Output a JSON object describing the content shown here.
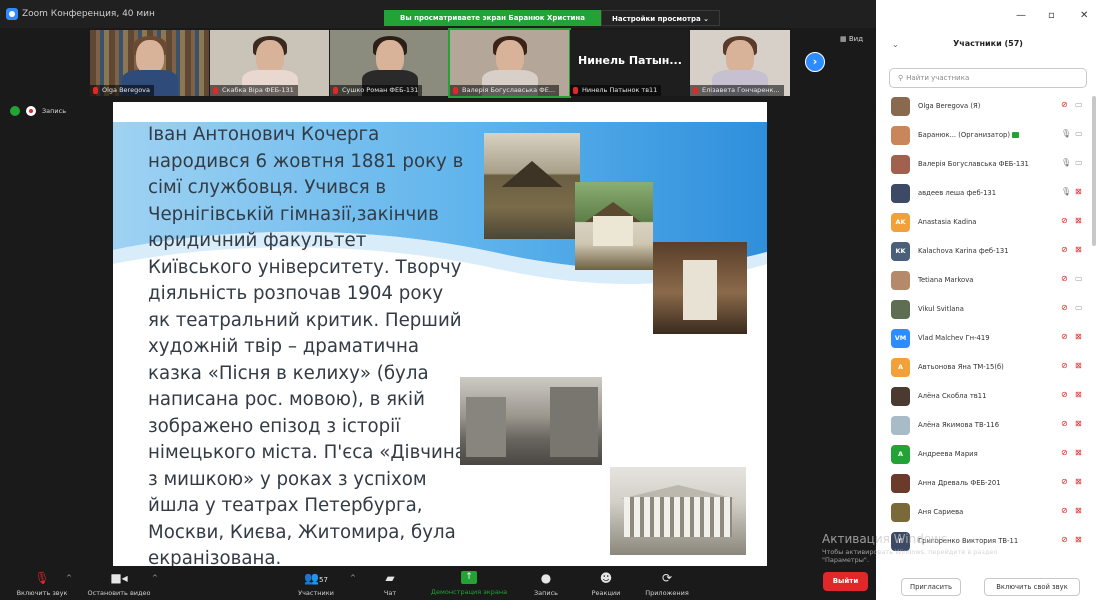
{
  "titlebar": {
    "title": "Zoom Конференция, 40 мин"
  },
  "share_banner": {
    "text": "Вы просматриваете экран Баранюк Христина",
    "options": "Настройки просмотра ⌄"
  },
  "thumbnails": [
    {
      "name": "Olga Beregova"
    },
    {
      "name": "Скабка Віра ФЕБ-131"
    },
    {
      "name": "Сушко Роман ФЕБ-131"
    },
    {
      "name": "Валерія Богуславська ФЕ..."
    },
    {
      "name": "Нинель Патынок тв11",
      "big_name": "Нинель  Патын..."
    },
    {
      "name": "Елізавета Гончаренк..."
    }
  ],
  "view_button": "▦ Вид",
  "record": {
    "label": "Запись"
  },
  "slide": {
    "lines": [
      "Іван Антонович Кочерга",
      "народився 6 жовтня 1881 року в",
      "сімї службовця. Учився в",
      "Чернігівській гімназії,закінчив",
      "юридичний факультет",
      "Київського університету. Творчу",
      "діяльність розпочав 1904 року",
      "як театральний критик. Перший",
      "художній твір – драматична",
      "казка «Пісня в келиху» (була",
      "написана рос. мовою), в якій",
      "зображено епізод з історії",
      "німецького міста. П'єса «Дівчина",
      "з мишкою» у роках з успіхом",
      "йшла у театрах Петербурга,",
      "Москви, Києва, Житомира, була",
      "екранізована."
    ]
  },
  "toolbar": {
    "mute": "Включить звук",
    "video": "Остановить видео",
    "participants": "Участники",
    "participants_count": "57",
    "chat": "Чат",
    "share": "Демонстрация экрана",
    "record": "Запись",
    "reactions": "Реакции",
    "apps": "Приложения",
    "exit": "Выйти"
  },
  "activation": {
    "line1": "Активация Windows",
    "line2": "Чтобы активировать Windows, перейдите в раздел",
    "line3": "\"Параметры\"."
  },
  "panel": {
    "title": "Участники (57)",
    "search_placeholder": "Найти участника",
    "invite": "Пригласить",
    "unmute_self": "Включить свой звук"
  },
  "participants": [
    {
      "name": "Olga Beregova (Я)",
      "avatar_text": "",
      "avatar_color": "#8a6a4f",
      "mic": "muted",
      "cam": "on"
    },
    {
      "name": "Баранюк... (Организатор)",
      "avatar_text": "",
      "avatar_color": "#c8865a",
      "mic": "on",
      "cam": "on",
      "host": true
    },
    {
      "name": "Валерія Богуславська ФЕБ-131",
      "avatar_text": "",
      "avatar_color": "#a0624e",
      "mic": "on",
      "cam": "on"
    },
    {
      "name": "авдеев леша феб-131",
      "avatar_text": "",
      "avatar_color": "#3c4a66",
      "mic": "on",
      "cam": "off"
    },
    {
      "name": "Anastasia Kadina",
      "avatar_text": "AK",
      "avatar_color": "#f2a03a",
      "mic": "muted",
      "cam": "off"
    },
    {
      "name": "Kalachova Karina феб-131",
      "avatar_text": "KK",
      "avatar_color": "#4a5f7a",
      "mic": "muted",
      "cam": "off"
    },
    {
      "name": "Tetiana Markova",
      "avatar_text": "",
      "avatar_color": "#b58a6a",
      "mic": "muted",
      "cam": "on"
    },
    {
      "name": "Vikul Svitlana",
      "avatar_text": "",
      "avatar_color": "#5e6e52",
      "mic": "muted",
      "cam": "on"
    },
    {
      "name": "Vlad Malchev Гн-419",
      "avatar_text": "VM",
      "avatar_color": "#2d8cff",
      "mic": "muted",
      "cam": "off"
    },
    {
      "name": "Автьонова Яна ТМ-15(б)",
      "avatar_text": "A",
      "avatar_color": "#f2a03a",
      "mic": "muted",
      "cam": "off"
    },
    {
      "name": "Алёна Скобла тв11",
      "avatar_text": "",
      "avatar_color": "#4a3a30",
      "mic": "muted",
      "cam": "off"
    },
    {
      "name": "Алёна Якимова ТВ-116",
      "avatar_text": "",
      "avatar_color": "#a8bcc8",
      "mic": "muted",
      "cam": "off"
    },
    {
      "name": "Андреева Мария",
      "avatar_text": "A",
      "avatar_color": "#23a335",
      "mic": "muted",
      "cam": "off"
    },
    {
      "name": "Анна Древаль ФЕБ-201",
      "avatar_text": "",
      "avatar_color": "#6a3a2a",
      "mic": "muted",
      "cam": "off"
    },
    {
      "name": "Аня Сариева",
      "avatar_text": "",
      "avatar_color": "#7a6a3a",
      "mic": "muted",
      "cam": "off"
    },
    {
      "name": "Григоренко Виктория ТВ-11",
      "avatar_text": "Г",
      "avatar_color": "#3c4a66",
      "mic": "muted",
      "cam": "off"
    }
  ]
}
